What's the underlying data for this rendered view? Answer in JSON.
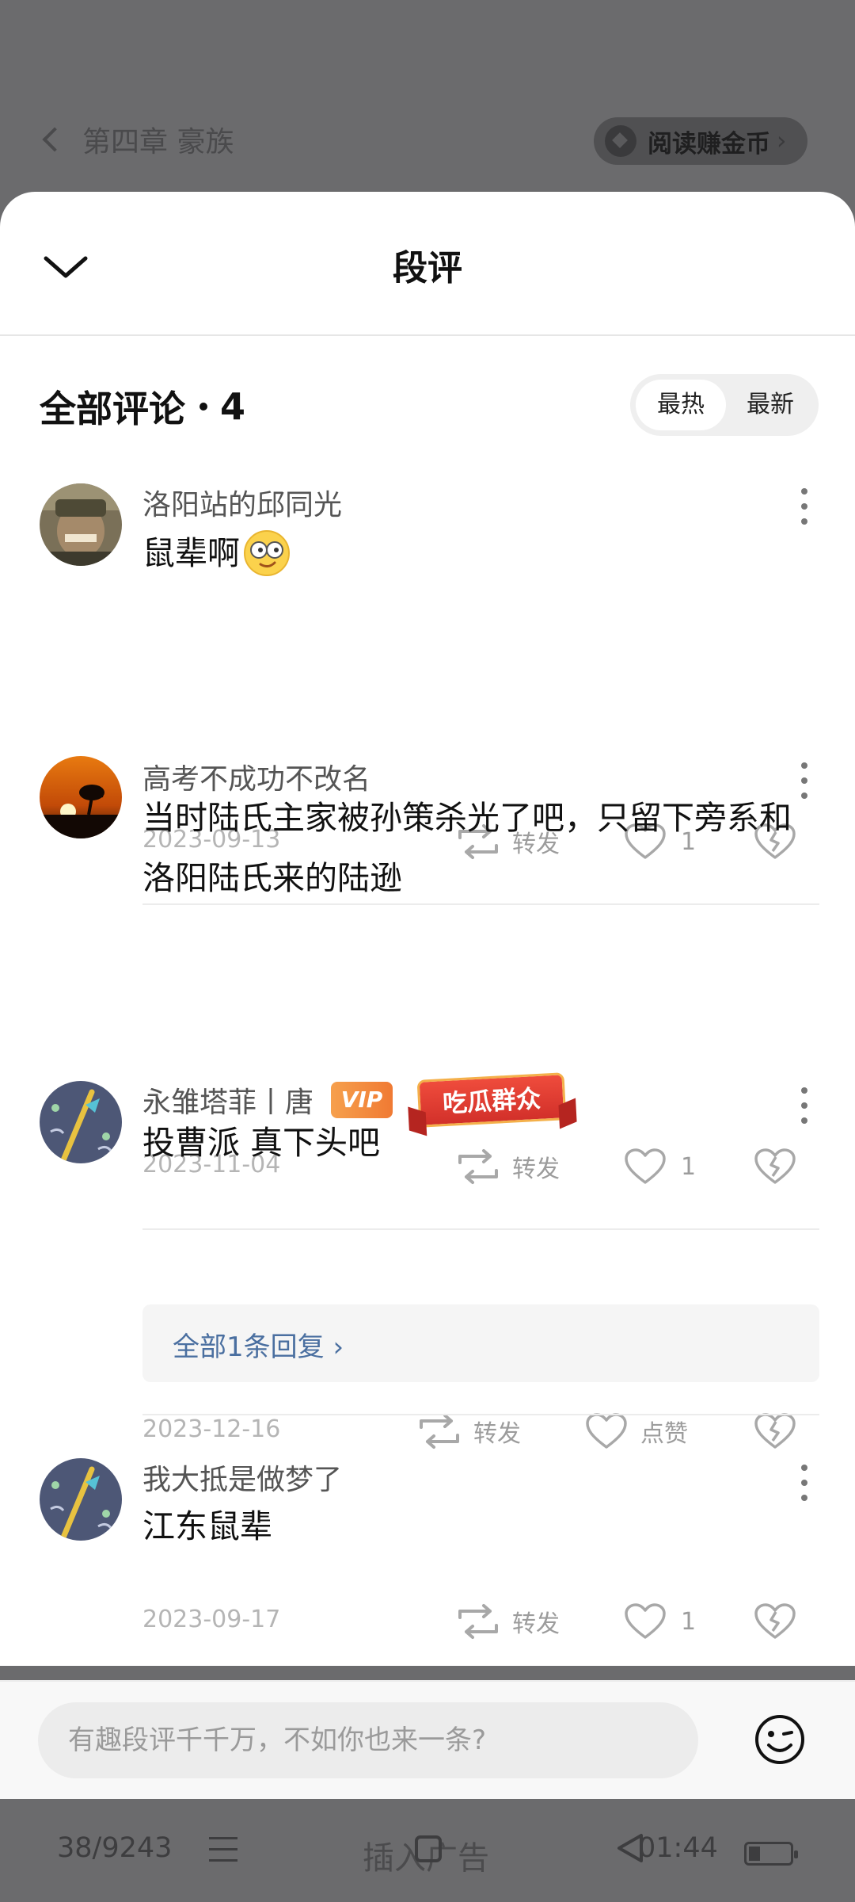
{
  "reader": {
    "chapter_title": "第四章 豪族",
    "coin_button": "阅读赚金币",
    "page_indicator": "38/9243",
    "ad_label": "插入广告",
    "clock": "01:44"
  },
  "sheet": {
    "title": "段评"
  },
  "list": {
    "title": "全部评论",
    "count": "4",
    "sort_hot": "最热",
    "sort_new": "最新"
  },
  "labels": {
    "repost": "转发",
    "like": "点赞"
  },
  "comments": [
    {
      "user": "洛阳站的邱同光",
      "text": "鼠辈啊",
      "date": "2023-09-13",
      "likes": "1"
    },
    {
      "user": "高考不成功不改名",
      "text": "当时陆氏主家被孙策杀光了吧，只留下旁系和洛阳陆氏来的陆逊",
      "date": "2023-11-04",
      "likes": "1"
    },
    {
      "user": "永雏塔菲丨唐",
      "vip_badge": "VIP",
      "medal": "吃瓜群众",
      "text": "投曹派 真下头吧",
      "date": "2023-12-16",
      "likes": "点赞",
      "replies": "全部1条回复 ›"
    },
    {
      "user": "我大抵是做梦了",
      "text": "江东鼠辈",
      "date": "2023-09-17",
      "likes": "1"
    }
  ],
  "input": {
    "placeholder": "有趣段评千千万，不如你也来一条?"
  }
}
